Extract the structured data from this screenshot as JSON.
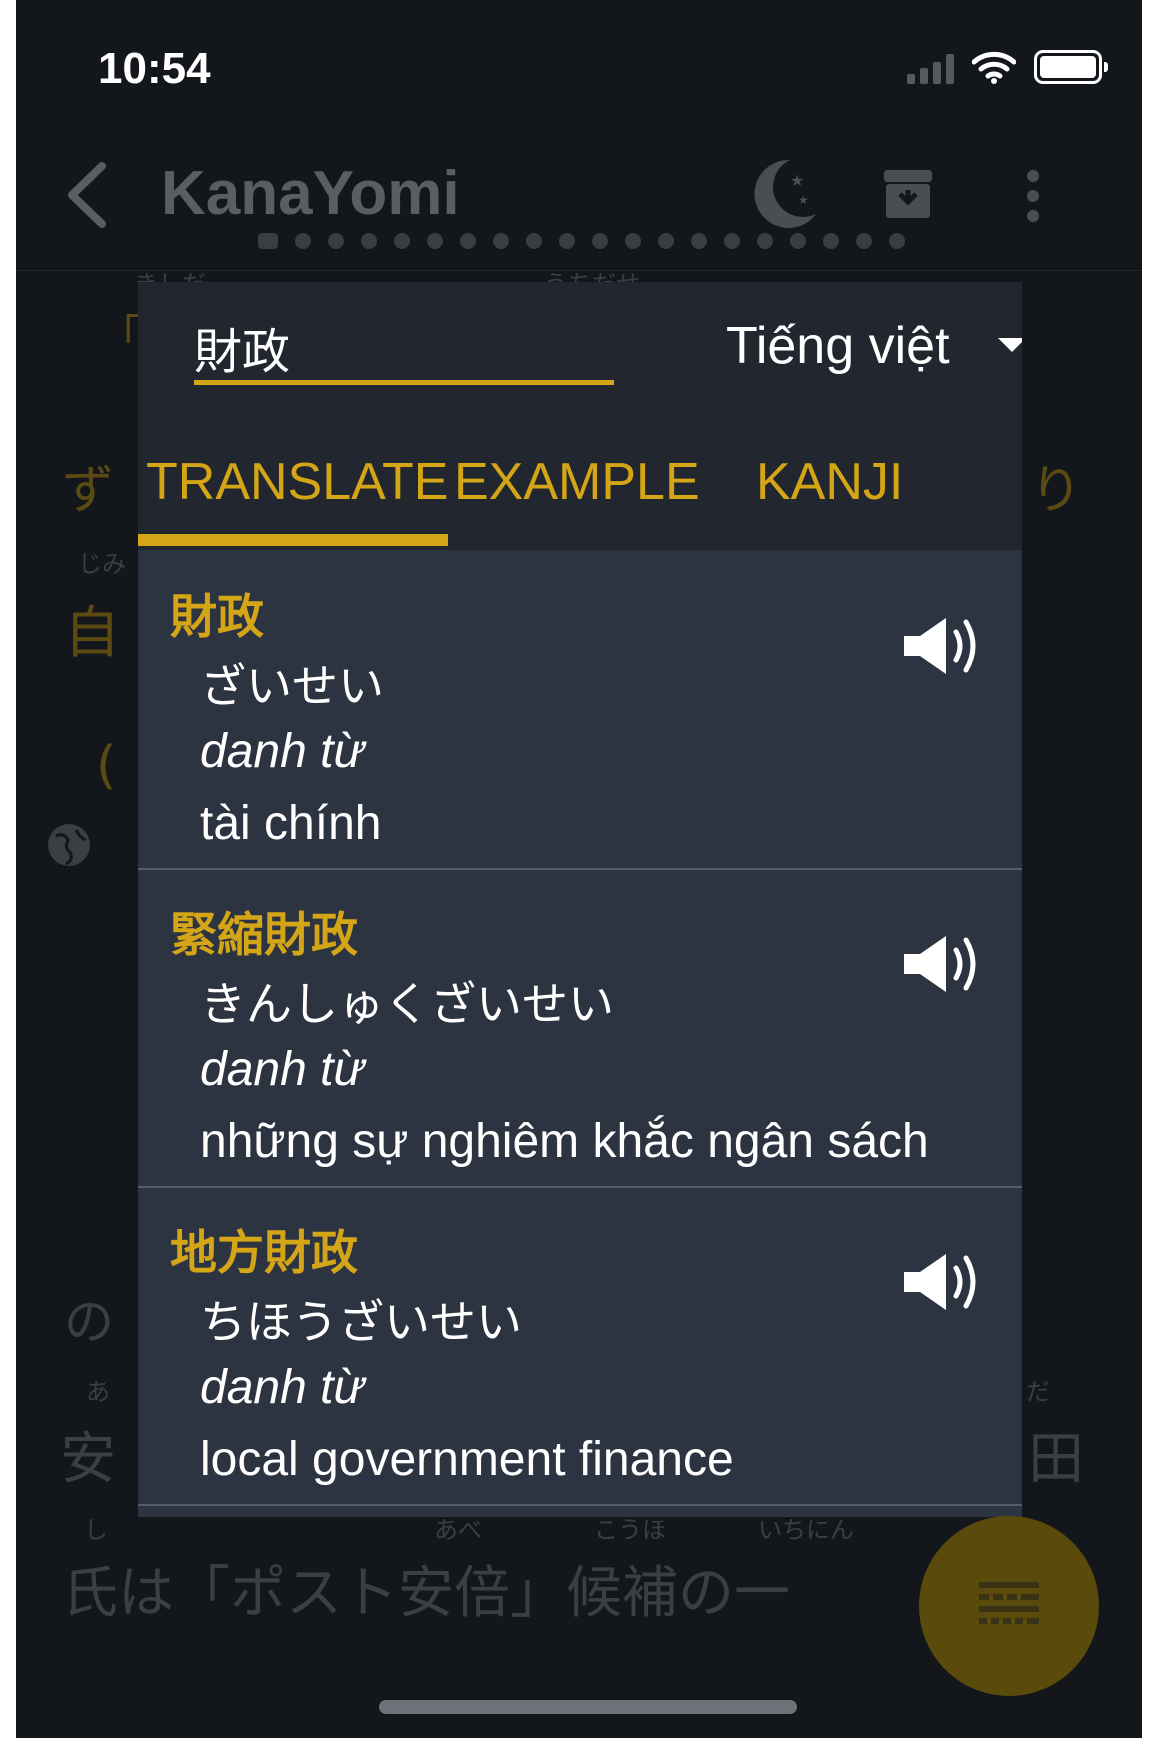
{
  "status_bar": {
    "time": "10:54"
  },
  "app_bar": {
    "title": "KanaYomi"
  },
  "background_article": {
    "furigana_1": "きしだ",
    "furigana_2": "うちだせ",
    "kanji_1": "「",
    "kana_1": "ず",
    "kana_2": "り",
    "furigana_3": "じみ",
    "kanji_2": "自",
    "paren": "(",
    "kana_3": "の",
    "furigana_4": "あ",
    "furigana_5": "だ",
    "kanji_3": "安",
    "kanji_4": "田",
    "furigana_6": "し",
    "furigana_7": "あべ",
    "furigana_8": "こうほ",
    "furigana_9": "いちにん",
    "last_line": "氏は「ポスト安倍」候補の一"
  },
  "dialog": {
    "search_value": "財政",
    "language": "Tiếng việt",
    "tabs": [
      {
        "label": "TRANSLATE",
        "active": true
      },
      {
        "label": "EXAMPLE",
        "active": false
      },
      {
        "label": "KANJI",
        "active": false
      }
    ],
    "entries": [
      {
        "word": "財政",
        "reading": "ざいせい",
        "pos": "danh từ",
        "meaning": "tài chính"
      },
      {
        "word": "緊縮財政",
        "reading": "きんしゅくざいせい",
        "pos": "danh từ",
        "meaning": "những sự nghiêm khắc ngân sách"
      },
      {
        "word": "地方財政",
        "reading": "ちほうざいせい",
        "pos": "danh từ",
        "meaning": "local government finance"
      }
    ]
  },
  "colors": {
    "accent": "#d4a516",
    "dialog_bg": "#2d3441",
    "header_bg": "#22272f",
    "app_bg": "#13161b"
  }
}
